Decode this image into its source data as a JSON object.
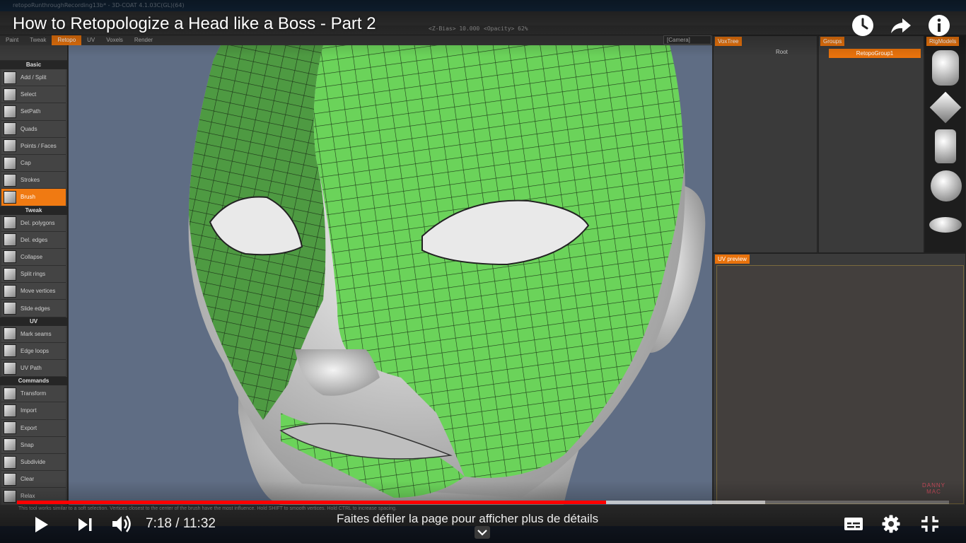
{
  "video": {
    "title": "How to Retopologize a Head like a Boss - Part 2",
    "current_time": "7:18",
    "duration": "11:32",
    "time_display": "7:18 / 11:32",
    "played_fraction": 0.632,
    "buffered_fraction": 0.803,
    "scroll_hint": "Faites défiler la page pour afficher plus de détails",
    "accent_color": "#ff0000"
  },
  "overlay_icons": {
    "watch_later": "clock-icon",
    "share": "share-arrow-icon",
    "info": "info-icon",
    "play": "play-icon",
    "next": "skip-next-icon",
    "volume": "volume-icon",
    "subtitles": "subtitles-icon",
    "settings": "gear-icon",
    "fullscreen_exit": "fullscreen-exit-icon",
    "expand": "chevron-down-icon"
  },
  "app": {
    "window_title": "retopoRunthroughRecording13b* - 3D-COAT 4.1.03C(GL)(64)",
    "toolbar_readouts": [
      "<Z-Bias> 10.000",
      "<Opacity> 62%"
    ],
    "room_tabs": [
      "Paint",
      "Tweak",
      "Retopo",
      "UV",
      "Voxels",
      "Render"
    ],
    "active_room": "Retopo",
    "camera_select": "[Camera]",
    "tool_sections": [
      {
        "title": "Basic",
        "items": [
          "Add / Split",
          "Select",
          "SetPath",
          "Quads",
          "Points / Faces",
          "Cap",
          "Strokes",
          "Brush"
        ]
      },
      {
        "title": "Tweak",
        "items": [
          "Del. polygons",
          "Del. edges",
          "Collapse",
          "Split rings",
          "Move vertices",
          "Slide edges"
        ]
      },
      {
        "title": "UV",
        "items": [
          "Mark seams",
          "Edge loops",
          "UV Path"
        ]
      },
      {
        "title": "Commands",
        "items": [
          "Transform",
          "Import",
          "Export",
          "Snap",
          "Subdivide",
          "Clear",
          "Relax"
        ]
      }
    ],
    "active_tool": "Brush",
    "panels": {
      "voxtree": "VoxTree",
      "voxtree_root": "Root",
      "groups": "Groups",
      "groups_item": "RetopoGroup1",
      "models": "RtgModels",
      "uv_preview": "UV preview"
    },
    "watermark_lines": [
      "DANNY",
      "MAC"
    ],
    "status_text": "This tool works similar to a soft selection. Vertices closest to the center of the brush have the most influence. Hold SHIFT to smooth vertices. Hold CTRL to increase spacing.",
    "mesh_color": "#6bd35a"
  }
}
